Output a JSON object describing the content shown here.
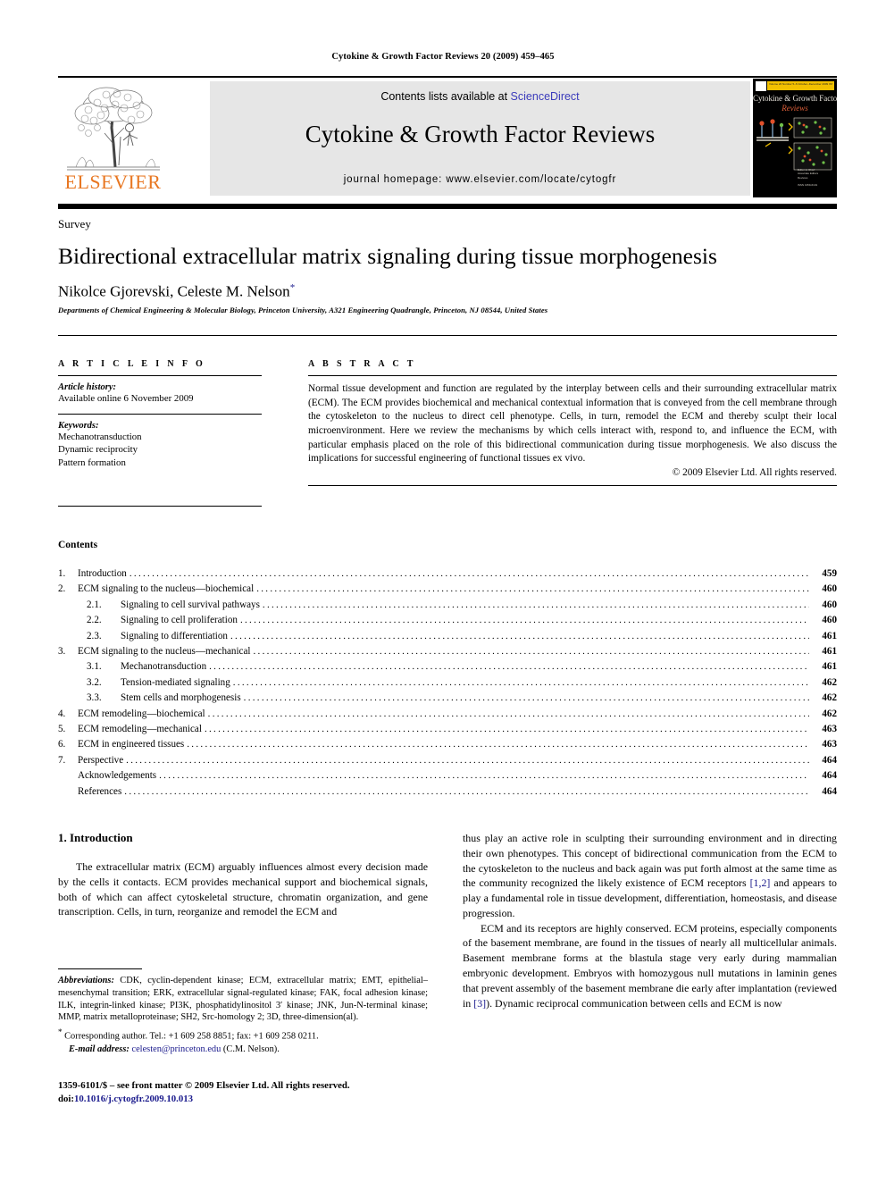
{
  "running_head": "Cytokine & Growth Factor Reviews 20 (2009) 459–465",
  "masthead": {
    "contents_prefix": "Contents lists available at ",
    "sciencedirect": "ScienceDirect",
    "journal_title": "Cytokine & Growth Factor Reviews",
    "homepage": "journal homepage: www.elsevier.com/locate/cytogfr",
    "publisher_wordmark": "ELSEVIER",
    "publisher_color": "#E87722",
    "sciencedirect_color": "#3b3bbb",
    "cover": {
      "banner_text": "Volume 20 Number 5–6   October–December 2009                ISSN 1359-6101",
      "title": "Cytokine & Growth Factor",
      "subtitle": "Reviews",
      "footer": "Editor-in-Chief\nMarjolein Kippenberger\nAssociate Editors\nReviews\n\nISSN 1359-6101\n© Elsevier Ltd",
      "banner_color": "#f2c100",
      "subtitle_color": "#e0603a"
    }
  },
  "article": {
    "type_label": "Survey",
    "title": "Bidirectional extracellular matrix signaling during tissue morphogenesis",
    "authors": "Nikolce Gjorevski, Celeste M. Nelson",
    "corresponding_marker": "*",
    "affiliation": "Departments of Chemical Engineering & Molecular Biology, Princeton University, A321 Engineering Quadrangle, Princeton, NJ 08544, United States"
  },
  "article_info": {
    "heading": "A R T I C L E   I N F O",
    "history_label": "Article history:",
    "history_value": "Available online 6 November 2009",
    "keywords_label": "Keywords:",
    "keywords": [
      "Mechanotransduction",
      "Dynamic reciprocity",
      "Pattern formation"
    ]
  },
  "abstract": {
    "heading": "A B S T R A C T",
    "body": "Normal tissue development and function are regulated by the interplay between cells and their surrounding extracellular matrix (ECM). The ECM provides biochemical and mechanical contextual information that is conveyed from the cell membrane through the cytoskeleton to the nucleus to direct cell phenotype. Cells, in turn, remodel the ECM and thereby sculpt their local microenvironment. Here we review the mechanisms by which cells interact with, respond to, and influence the ECM, with particular emphasis placed on the role of this bidirectional communication during tissue morphogenesis. We also discuss the implications for successful engineering of functional tissues ex vivo.",
    "copyright": "© 2009 Elsevier Ltd. All rights reserved."
  },
  "contents": {
    "heading": "Contents",
    "entries": [
      {
        "num": "1.",
        "level": 1,
        "label": "Introduction",
        "page": "459"
      },
      {
        "num": "2.",
        "level": 1,
        "label": "ECM signaling to the nucleus—biochemical",
        "page": "460"
      },
      {
        "num": "2.1.",
        "level": 2,
        "label": "Signaling to cell survival pathways",
        "page": "460"
      },
      {
        "num": "2.2.",
        "level": 2,
        "label": "Signaling to cell proliferation",
        "page": "460"
      },
      {
        "num": "2.3.",
        "level": 2,
        "label": "Signaling to differentiation",
        "page": "461"
      },
      {
        "num": "3.",
        "level": 1,
        "label": "ECM signaling to the nucleus—mechanical",
        "page": "461"
      },
      {
        "num": "3.1.",
        "level": 2,
        "label": "Mechanotransduction",
        "page": "461"
      },
      {
        "num": "3.2.",
        "level": 2,
        "label": "Tension-mediated signaling",
        "page": "462"
      },
      {
        "num": "3.3.",
        "level": 2,
        "label": "Stem cells and morphogenesis",
        "page": "462"
      },
      {
        "num": "4.",
        "level": 1,
        "label": "ECM remodeling—biochemical",
        "page": "462"
      },
      {
        "num": "5.",
        "level": 1,
        "label": "ECM remodeling—mechanical",
        "page": "463"
      },
      {
        "num": "6.",
        "level": 1,
        "label": "ECM in engineered tissues",
        "page": "463"
      },
      {
        "num": "7.",
        "level": 1,
        "label": "Perspective",
        "page": "464"
      },
      {
        "num": "",
        "level": 1,
        "label": "Acknowledgements",
        "page": "464"
      },
      {
        "num": "",
        "level": 1,
        "label": "References",
        "page": "464"
      }
    ]
  },
  "body": {
    "section_heading": "1. Introduction",
    "left_paragraph": "The extracellular matrix (ECM) arguably influences almost every decision made by the cells it contacts. ECM provides mechanical support and biochemical signals, both of which can affect cytoskeletal structure, chromatin organization, and gene transcription. Cells, in turn, reorganize and remodel the ECM and",
    "right_paragraph_1a": "thus play an active role in sculpting their surrounding environment and in directing their own phenotypes. This concept of bidirectional communication from the ECM to the cytoskeleton to the nucleus and back again was put forth almost at the same time as the community recognized the likely existence of ECM receptors ",
    "right_citation_1": "[1,2]",
    "right_paragraph_1b": " and appears to play a fundamental role in tissue development, differentiation, homeostasis, and disease progression.",
    "right_paragraph_2a": "ECM and its receptors are highly conserved. ECM proteins, especially components of the basement membrane, are found in the tissues of nearly all multicellular animals. Basement membrane forms at the blastula stage very early during mammalian embryonic development. Embryos with homozygous null mutations in laminin genes that prevent assembly of the basement membrane die early after implantation (reviewed in ",
    "right_citation_2": "[3]",
    "right_paragraph_2b": "). Dynamic reciprocal communication between cells and ECM is now"
  },
  "footnotes": {
    "abbreviations_label": "Abbreviations:",
    "abbreviations_text": " CDK, cyclin-dependent kinase; ECM, extracellular matrix; EMT, epithelial–mesenchymal transition; ERK, extracellular signal-regulated kinase; FAK, focal adhesion kinase; ILK, integrin-linked kinase; PI3K, phosphatidylinositol 3′ kinase; JNK, Jun-N-terminal kinase; MMP, matrix metalloproteinase; SH2, Src-homology 2; 3D, three-dimension(al).",
    "corresponding_marker": "*",
    "corresponding_text": "Corresponding author. Tel.: +1 609 258 8851; fax: +1 609 258 0211.",
    "email_label": "E-mail address:",
    "email": "celesten@princeton.edu",
    "email_suffix": " (C.M. Nelson)."
  },
  "imprint": {
    "line1": "1359-6101/$ – see front matter © 2009 Elsevier Ltd. All rights reserved.",
    "doi_label": "doi:",
    "doi_value": "10.1016/j.cytogfr.2009.10.013"
  }
}
